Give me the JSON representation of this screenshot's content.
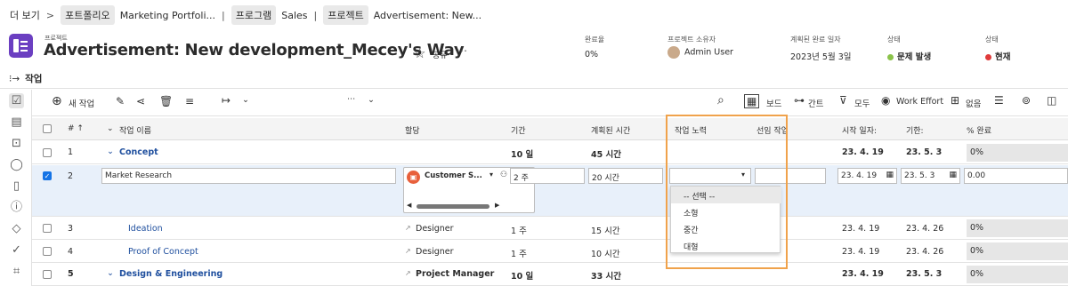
{
  "breadcrumb": {
    "more": "더 보기",
    "portfolio_label": "포트폴리오",
    "portfolio_name": "Marketing Portfoli...",
    "program_label": "프로그램",
    "program_name": "Sales",
    "project_label": "프로젝트",
    "project_name": "Advertisement: New..."
  },
  "header": {
    "type": "프로젝트",
    "title": "Advertisement: New development_Mecey's Way",
    "share": "공유",
    "more": "⋯"
  },
  "meta": [
    {
      "label": "완료율",
      "value": "0%"
    },
    {
      "label": "프로젝트 소유자",
      "value": "Admin User"
    },
    {
      "label": "계획된 완료 일자",
      "value": "2023년 5월 3일"
    },
    {
      "label": "상태",
      "value": "문제 발생",
      "color": "#8bc34a"
    },
    {
      "label": "상태",
      "value": "현재",
      "color": "#e03b3b"
    }
  ],
  "tab": {
    "label": "작업"
  },
  "toolbar": {
    "new_task": "새 작업",
    "board": "보드",
    "gantt": "간트",
    "filter_all": "모두",
    "work_effort": "Work Effort",
    "none": "없음",
    "more": "⋯"
  },
  "columns": {
    "num": "# ↑",
    "name": "작업 이름",
    "assign": "할당",
    "duration": "기간",
    "planned_hours": "계획된 시간",
    "work_effort": "작업 노력",
    "prev_task": "선임 작업",
    "start": "시작 일자:",
    "due": "기한:",
    "pct": "% 완료"
  },
  "rows": [
    {
      "num": "1",
      "name": "Concept",
      "assign": "",
      "duration": "10 일",
      "hours": "45 시간",
      "start": "23. 4. 19",
      "due": "23. 5. 3",
      "pct": "0%"
    },
    {
      "num": "2",
      "name": "Market Research",
      "assign": "Customer S...",
      "duration": "2 주",
      "hours": "20 시간",
      "effort": "",
      "start": "23. 4. 19",
      "due": "23. 5. 3",
      "pct": "0.00"
    },
    {
      "num": "3",
      "name": "Ideation",
      "assign": "Designer",
      "duration": "1 주",
      "hours": "15 시간",
      "start": "23. 4. 19",
      "due": "23. 4. 26",
      "pct": "0%"
    },
    {
      "num": "4",
      "name": "Proof of Concept",
      "assign": "Designer",
      "duration": "1 주",
      "hours": "10 시간",
      "start": "23. 4. 19",
      "due": "23. 4. 26",
      "pct": "0%"
    },
    {
      "num": "5",
      "name": "Design & Engineering",
      "assign": "Project Manager",
      "duration": "10 일",
      "hours": "33 시간",
      "start": "23. 4. 19",
      "due": "23. 5. 3",
      "pct": "0%"
    }
  ],
  "dropdown": {
    "options": [
      "-- 선택 --",
      "소형",
      "중간",
      "대형"
    ]
  },
  "colors": {
    "accent": "#1473e6",
    "highlight": "#f0a24b",
    "project_icon": "#6b3fc1"
  }
}
